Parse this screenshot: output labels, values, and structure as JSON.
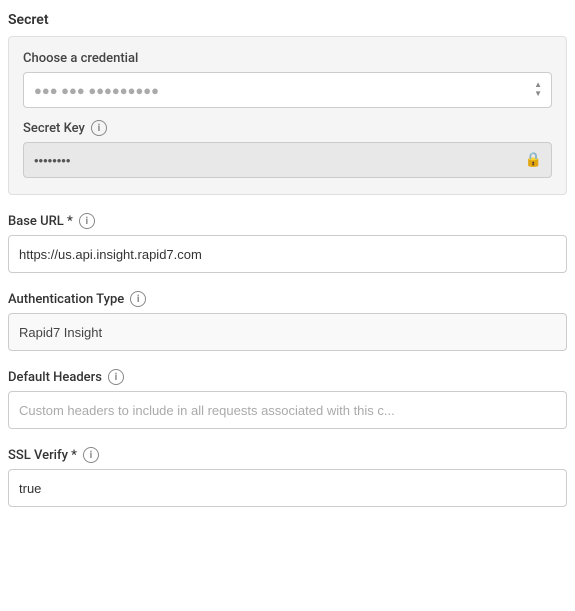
{
  "secret_section": {
    "label": "Secret",
    "credential": {
      "label": "Choose a credential",
      "value": "●●● ●●● ●●●●●●●●●",
      "placeholder": "Choose a credential"
    },
    "secret_key": {
      "label": "Secret Key",
      "value": "••••••••",
      "placeholder": "••••••••"
    }
  },
  "base_url": {
    "label": "Base URL",
    "required": true,
    "value": "https://us.api.insight.rapid7.com",
    "placeholder": "https://us.api.insight.rapid7.com"
  },
  "auth_type": {
    "label": "Authentication Type",
    "value": "Rapid7 Insight",
    "placeholder": ""
  },
  "default_headers": {
    "label": "Default Headers",
    "value": "",
    "placeholder": "Custom headers to include in all requests associated with this c..."
  },
  "ssl_verify": {
    "label": "SSL Verify",
    "required": true,
    "value": "true",
    "placeholder": ""
  },
  "icons": {
    "info": "i",
    "lock": "🔒",
    "select_arrow_up": "▲",
    "select_arrow_down": "▼"
  },
  "colors": {
    "accent": "#0073e6",
    "border": "#ccc",
    "bg_light": "#f5f5f5",
    "bg_input_locked": "#e8e8e8"
  }
}
